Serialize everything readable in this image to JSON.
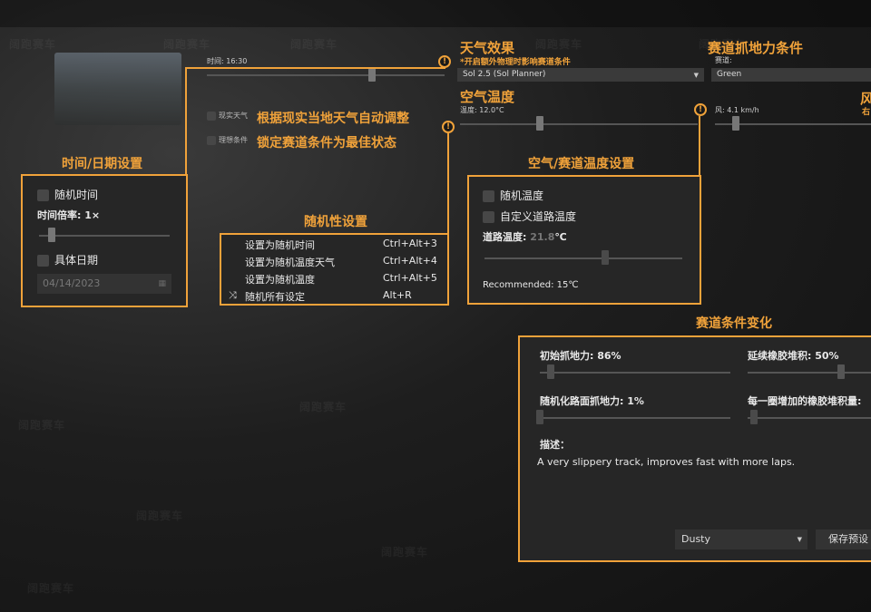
{
  "top_weather": {
    "time_label": "时间: 16:30",
    "weather_title": "天气效果",
    "weather_sub": "*开启额外物理时影响赛道条件",
    "weather_select": "Sol 2.5 (Sol Planner)",
    "air_temp_title": "空气温度",
    "air_temp_label": "温度: 12.0°C",
    "grip_title": "赛道抓地力条件",
    "grip_select_label": "赛道:",
    "grip_select": "Green",
    "wind_label": "风: 4.1 km/h",
    "wind_title_partial": "风",
    "wind_sub_partial": "右"
  },
  "realtime": {
    "real_weather_label": "现实天气",
    "real_weather_note": "根据现实当地天气自动调整",
    "ideal_label": "理想条件",
    "ideal_note": "锁定赛道条件为最佳状态"
  },
  "time_panel": {
    "title": "时间/日期设置",
    "random_time": "随机时间",
    "time_scale": "时间倍率: 1×",
    "specific_date": "具体日期",
    "date_value": "04/14/2023"
  },
  "random_panel": {
    "title": "随机性设置",
    "items": [
      {
        "label": "设置为随机时间",
        "shortcut": "Ctrl+Alt+3"
      },
      {
        "label": "设置为随机温度天气",
        "shortcut": "Ctrl+Alt+4"
      },
      {
        "label": "设置为随机温度",
        "shortcut": "Ctrl+Alt+5"
      },
      {
        "label": "随机所有设定",
        "shortcut": "Alt+R"
      }
    ]
  },
  "temp_panel": {
    "title": "空气/赛道温度设置",
    "random_temp": "随机温度",
    "custom_road_temp": "自定义道路温度",
    "road_temp_label": "道路温度: ",
    "road_temp_value": "21.8",
    "road_temp_unit": "℃",
    "recommended": "Recommended: 15℃"
  },
  "track_panel": {
    "title": "赛道条件变化",
    "initial_grip": "初始抓地力: 86%",
    "rubber_build": "延续橡胶堆积: 50%",
    "random_surface_grip": "随机化路面抓地力: 1%",
    "rubber_per_lap": "每一圈增加的橡胶堆积量:",
    "desc_label": "描述：",
    "description": "A very slippery track, improves fast with more laps.",
    "preset_select": "Dusty",
    "save_preset": "保存预设"
  },
  "watermark": "阔跑赛车"
}
